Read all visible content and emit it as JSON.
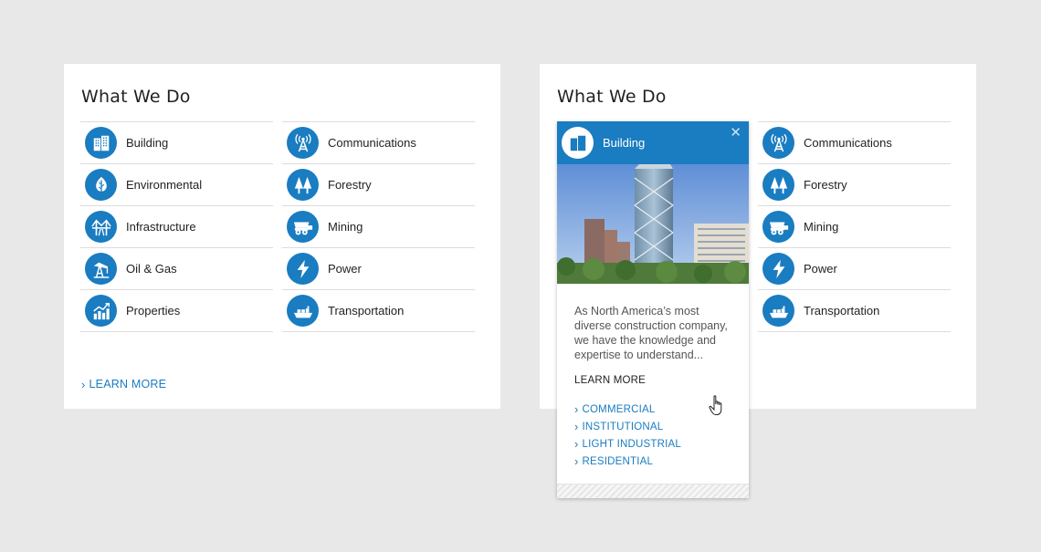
{
  "left_card": {
    "title": "What We Do",
    "col_a": [
      {
        "label": "Building",
        "icon": "building-icon"
      },
      {
        "label": "Environmental",
        "icon": "leaf-icon"
      },
      {
        "label": "Infrastructure",
        "icon": "bridge-icon"
      },
      {
        "label": "Oil & Gas",
        "icon": "oil-pump-icon"
      },
      {
        "label": "Properties",
        "icon": "chart-up-icon"
      }
    ],
    "col_b": [
      {
        "label": "Communications",
        "icon": "antenna-icon"
      },
      {
        "label": "Forestry",
        "icon": "trees-icon"
      },
      {
        "label": "Mining",
        "icon": "mining-truck-icon"
      },
      {
        "label": "Power",
        "icon": "lightning-icon"
      },
      {
        "label": "Transportation",
        "icon": "ship-icon"
      }
    ],
    "learn_more": "LEARN MORE"
  },
  "right_card": {
    "title": "What We Do",
    "col_b": [
      {
        "label": "Communications",
        "icon": "antenna-icon"
      },
      {
        "label": "Forestry",
        "icon": "trees-icon"
      },
      {
        "label": "Mining",
        "icon": "mining-truck-icon"
      },
      {
        "label": "Power",
        "icon": "lightning-icon"
      },
      {
        "label": "Transportation",
        "icon": "ship-icon"
      }
    ]
  },
  "popup": {
    "title": "Building",
    "icon": "building-icon",
    "close_glyph": "✕",
    "description": "As North America’s most diverse construction company, we have the knowledge and expertise to understand...",
    "learn_more": "LEARN MORE",
    "links": [
      "COMMERCIAL",
      "INSTITUTIONAL",
      "LIGHT INDUSTRIAL",
      "RESIDENTIAL"
    ]
  },
  "colors": {
    "accent": "#1a7cc1",
    "background": "#e8e8e8",
    "card": "#ffffff"
  }
}
